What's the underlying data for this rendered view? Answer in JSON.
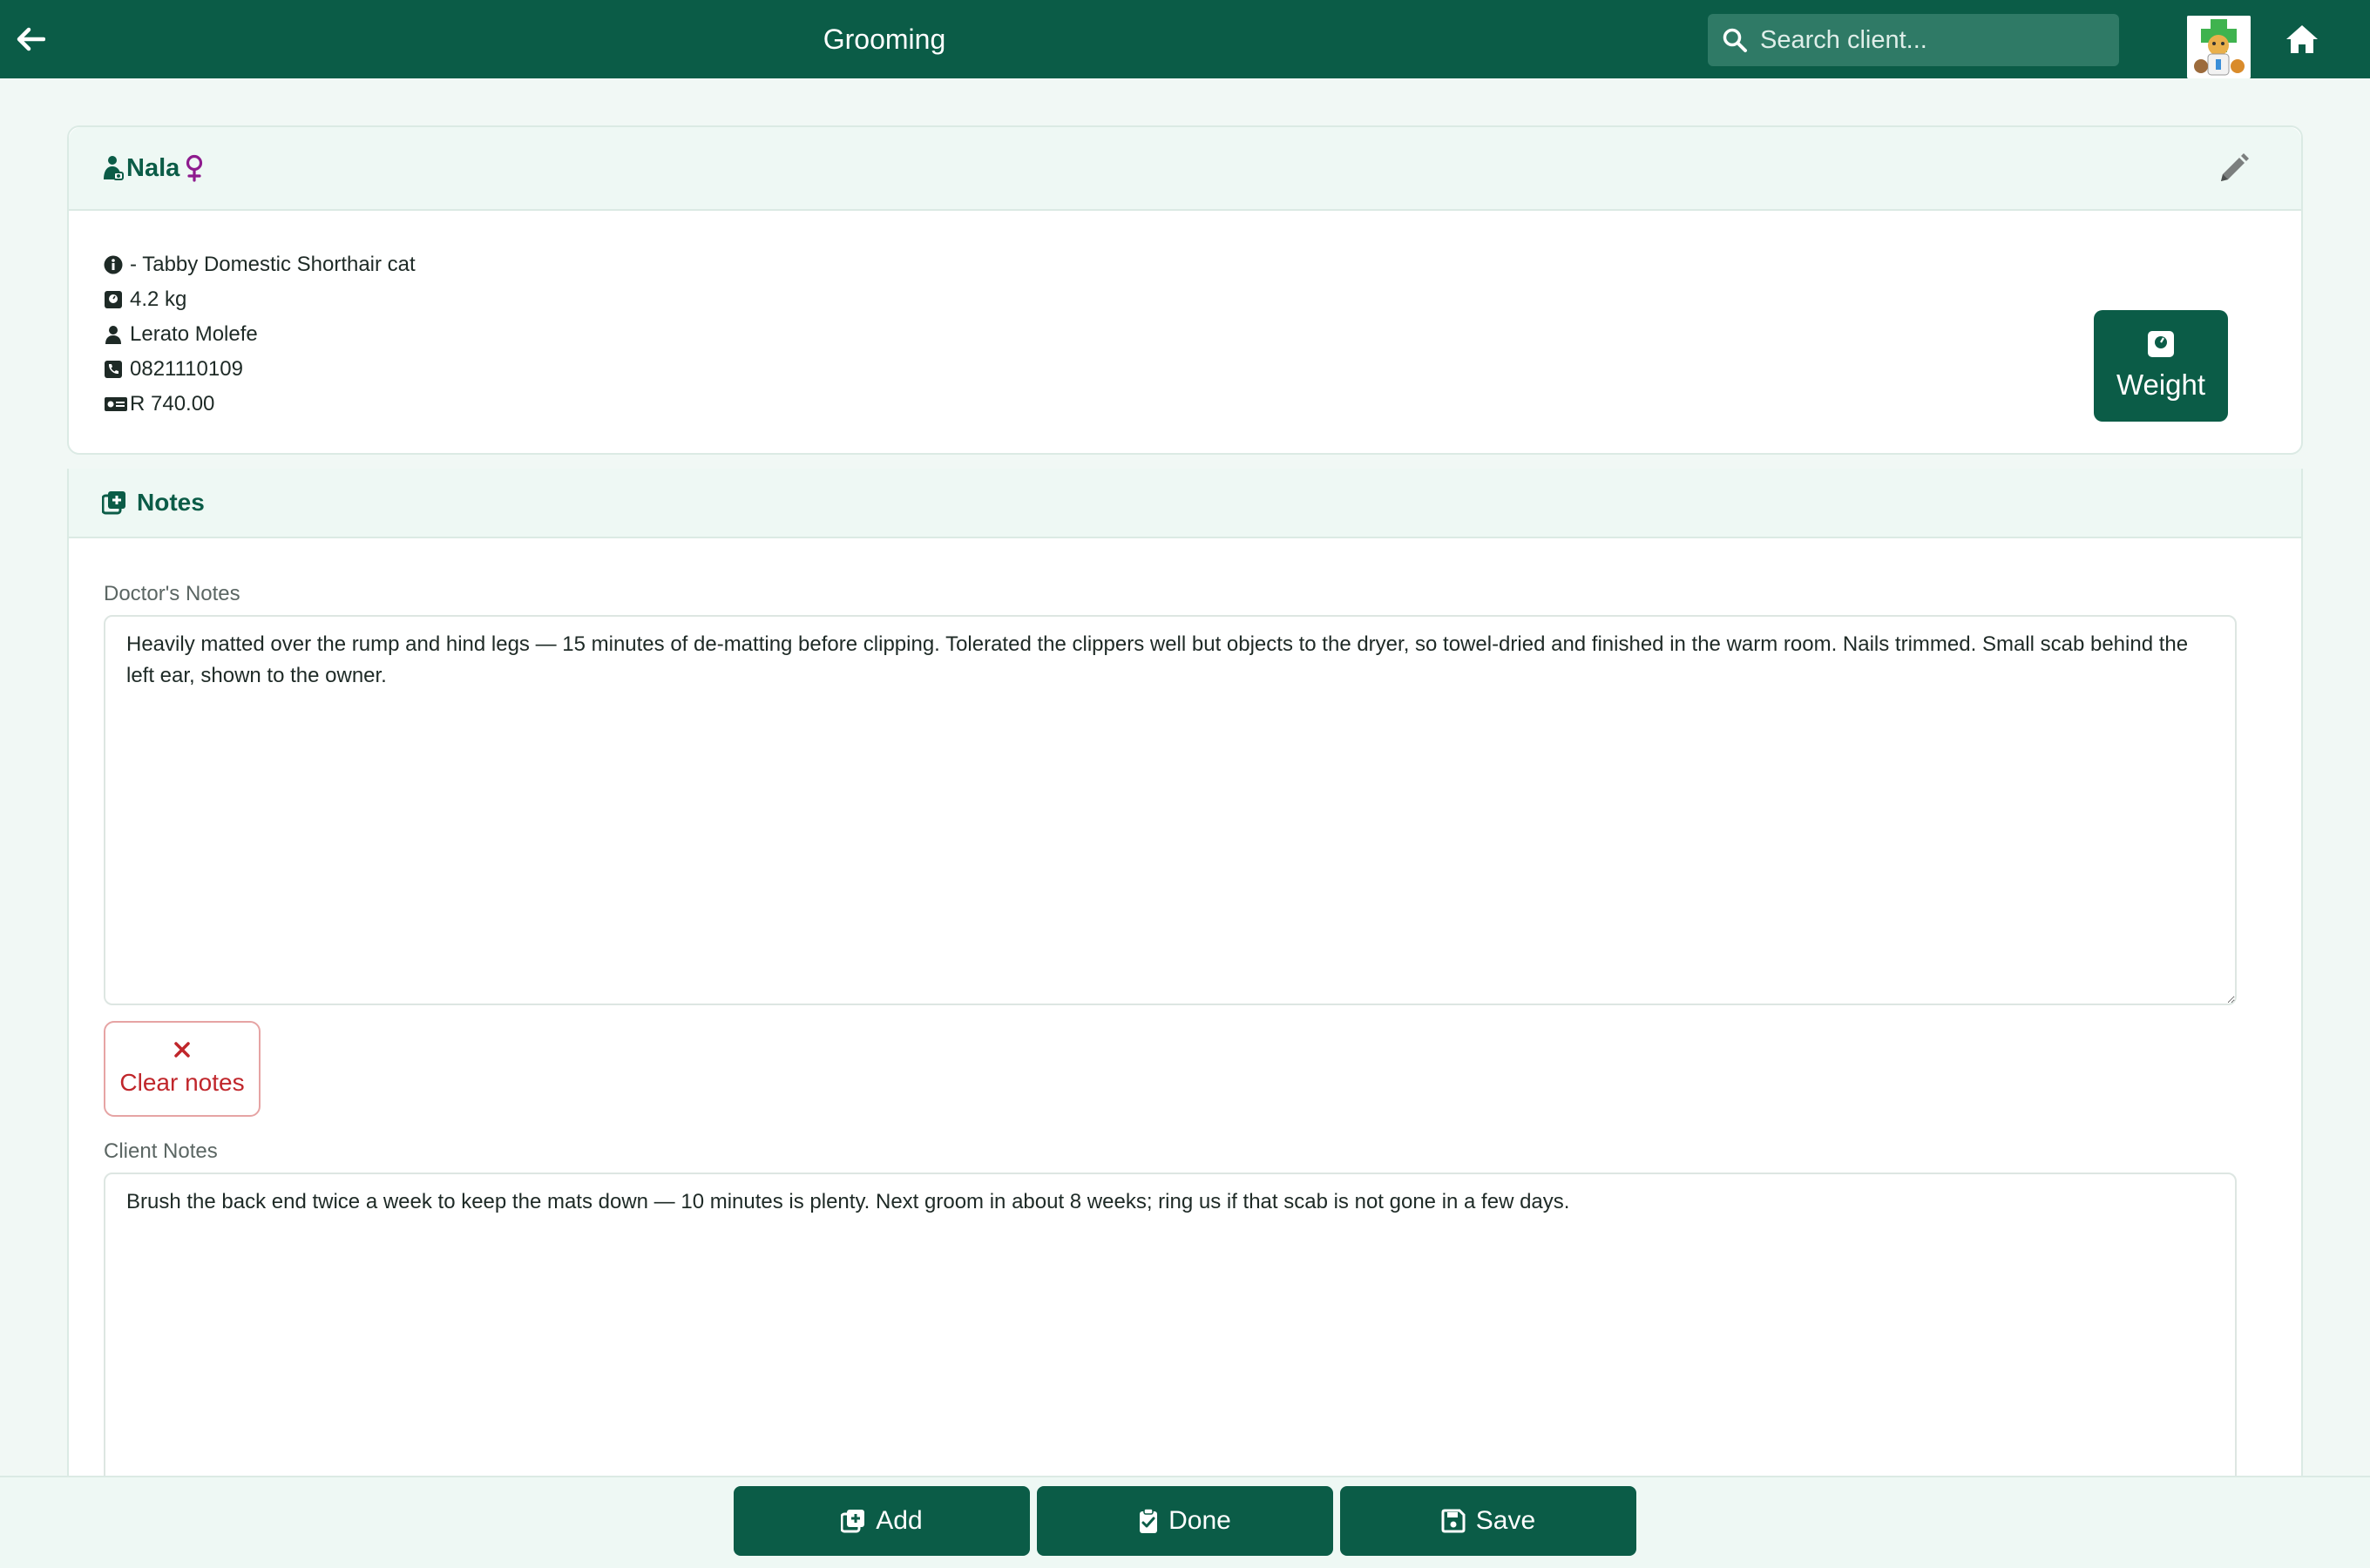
{
  "header": {
    "title": "Grooming",
    "search_placeholder": "Search client..."
  },
  "patient": {
    "name": "Nala",
    "description": "- Tabby Domestic Shorthair cat",
    "weight": "4.2 kg",
    "owner": "Lerato Molefe",
    "phone": "0821110109",
    "balance": "R 740.00",
    "weight_button_label": "Weight"
  },
  "notes": {
    "section_title": "Notes",
    "doctor_label": "Doctor's Notes",
    "doctor_value": "Heavily matted over the rump and hind legs — 15 minutes of de-matting before clipping. Tolerated the clippers well but objects to the dryer, so towel-dried and finished in the warm room. Nails trimmed. Small scab behind the left ear, shown to the owner.",
    "clear_label": "Clear notes",
    "client_label": "Client Notes",
    "client_value": "Brush the back end twice a week to keep the mats down — 10 minutes is plenty. Next groom in about 8 weeks; ring us if that scab is not gone in a few days."
  },
  "footer": {
    "add_label": "Add",
    "done_label": "Done",
    "save_label": "Save"
  },
  "colors": {
    "brand": "#0b5c47",
    "danger": "#c0262b",
    "female": "#8e1b8e"
  }
}
